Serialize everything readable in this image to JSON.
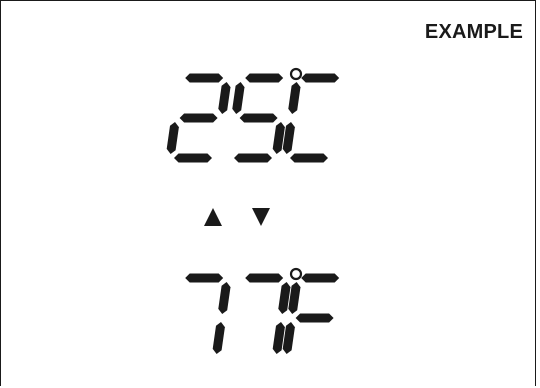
{
  "label": "EXAMPLE",
  "display": {
    "celsius": {
      "digits": [
        "2",
        "5"
      ],
      "unit_glyph": "°C"
    },
    "fahrenheit": {
      "digits": [
        "7",
        "7"
      ],
      "unit_glyph": "°F"
    }
  },
  "arrows": [
    "up",
    "down"
  ],
  "colors": {
    "segment": "#1a1a1a",
    "background": "#ffffff"
  }
}
